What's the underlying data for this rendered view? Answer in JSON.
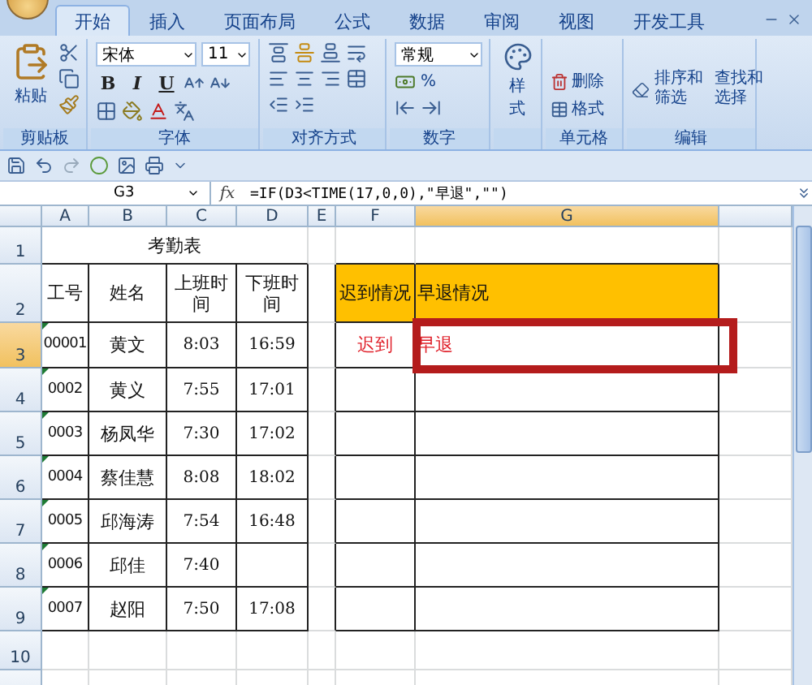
{
  "tabs": [
    {
      "label": "开始",
      "selected": true
    },
    {
      "label": "插入",
      "selected": false
    },
    {
      "label": "页面布局",
      "selected": false
    },
    {
      "label": "公式",
      "selected": false
    },
    {
      "label": "数据",
      "selected": false
    },
    {
      "label": "审阅",
      "selected": false
    },
    {
      "label": "视图",
      "selected": false
    },
    {
      "label": "开发工具",
      "selected": false
    }
  ],
  "ribbon": {
    "groups": [
      {
        "kind": "clipboard",
        "label": "剪贴板",
        "paste": "粘贴"
      },
      {
        "kind": "font",
        "label": "字体",
        "font": "宋体",
        "size": "11",
        "styles": [
          "B",
          "I",
          "U"
        ]
      },
      {
        "kind": "align",
        "label": "对齐方式"
      },
      {
        "kind": "number",
        "label": "数字",
        "format": "常规",
        "percent": "%"
      },
      {
        "kind": "styles",
        "button": "样式"
      },
      {
        "kind": "cells",
        "label": "单元格",
        "buttons": [
          "删除",
          "格式"
        ]
      },
      {
        "kind": "editing",
        "label": "编辑",
        "buttons": [
          "排序和筛选",
          "查找和选择"
        ]
      }
    ]
  },
  "formula_bar": {
    "name_box": "G3",
    "function_label": "fx",
    "formula": "=IF(D3<TIME(17,0,0),\"早退\",\"\")"
  },
  "sheet": {
    "columns": [
      {
        "label": "A",
        "selected": false
      },
      {
        "label": "B",
        "selected": false
      },
      {
        "label": "C",
        "selected": false
      },
      {
        "label": "D",
        "selected": false
      },
      {
        "label": "E",
        "selected": false
      },
      {
        "label": "F",
        "selected": false
      },
      {
        "label": "G",
        "selected": true
      }
    ],
    "rows": [
      {
        "number": "1",
        "selected": false,
        "title": "考勤表"
      },
      {
        "number": "2",
        "selected": false,
        "cells": [
          {
            "text": "工号",
            "kind": "label"
          },
          {
            "text": "姓名",
            "kind": "label"
          },
          {
            "text": "上班时间",
            "kind": "label"
          },
          {
            "text": "下班时间",
            "kind": "label"
          },
          "",
          {
            "text": "迟到情况",
            "kind": "highlight"
          },
          {
            "text": "早退情况",
            "kind": "highlight"
          }
        ]
      },
      {
        "number": "3",
        "selected": true,
        "cells": [
          {
            "text": "00001",
            "kind": "id",
            "flag": true
          },
          {
            "text": "黄文",
            "kind": "label"
          },
          {
            "text": "8:03",
            "kind": "time"
          },
          {
            "text": "16:59",
            "kind": "time"
          },
          "",
          {
            "text": "迟到",
            "kind": "alert"
          },
          {
            "text": "早退",
            "kind": "alert"
          }
        ]
      },
      {
        "number": "4",
        "selected": false,
        "cells": [
          {
            "text": "0002",
            "kind": "id",
            "flag": true
          },
          {
            "text": "黄义",
            "kind": "label"
          },
          {
            "text": "7:55",
            "kind": "time"
          },
          {
            "text": "17:01",
            "kind": "time"
          }
        ]
      },
      {
        "number": "5",
        "selected": false,
        "cells": [
          {
            "text": "0003",
            "kind": "id",
            "flag": true
          },
          {
            "text": "杨凤华",
            "kind": "label"
          },
          {
            "text": "7:30",
            "kind": "time"
          },
          {
            "text": "17:02",
            "kind": "time"
          }
        ]
      },
      {
        "number": "6",
        "selected": false,
        "cells": [
          {
            "text": "0004",
            "kind": "id",
            "flag": true
          },
          {
            "text": "蔡佳慧",
            "kind": "label"
          },
          {
            "text": "8:08",
            "kind": "time"
          },
          {
            "text": "18:02",
            "kind": "time"
          }
        ]
      },
      {
        "number": "7",
        "selected": false,
        "cells": [
          {
            "text": "0005",
            "kind": "id",
            "flag": true
          },
          {
            "text": "邱海涛",
            "kind": "label"
          },
          {
            "text": "7:54",
            "kind": "time"
          },
          {
            "text": "16:48",
            "kind": "time"
          }
        ]
      },
      {
        "number": "8",
        "selected": false,
        "cells": [
          {
            "text": "0006",
            "kind": "id",
            "flag": true
          },
          {
            "text": "邱佳",
            "kind": "label"
          },
          {
            "text": "7:40",
            "kind": "time"
          }
        ]
      },
      {
        "number": "9",
        "selected": false,
        "cells": [
          {
            "text": "0007",
            "kind": "id",
            "flag": true
          },
          {
            "text": "赵阳",
            "kind": "label"
          },
          {
            "text": "7:50",
            "kind": "time"
          },
          {
            "text": "17:08",
            "kind": "time"
          }
        ]
      },
      {
        "number": "10",
        "selected": false
      }
    ]
  }
}
